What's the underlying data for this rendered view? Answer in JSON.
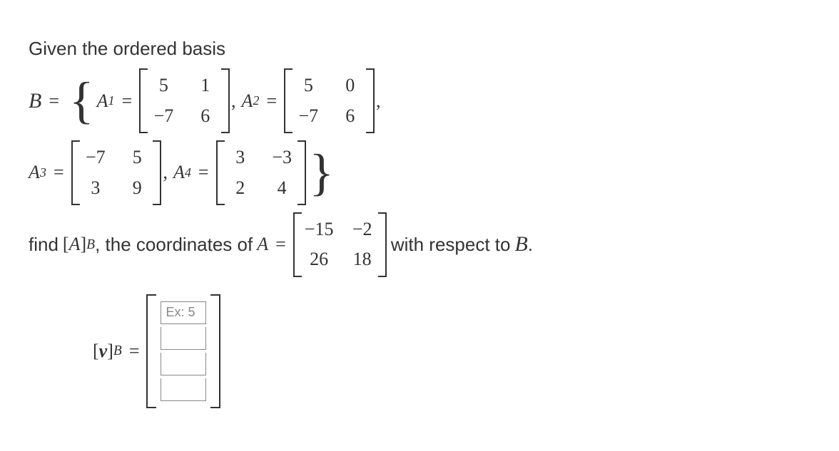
{
  "intro": "Given the ordered basis",
  "problem": {
    "basis_symbol": "B",
    "A1": {
      "name": "A",
      "index": "1",
      "cells": [
        "5",
        "1",
        "−7",
        "6"
      ]
    },
    "A2": {
      "name": "A",
      "index": "2",
      "cells": [
        "5",
        "0",
        "−7",
        "6"
      ]
    },
    "A3": {
      "name": "A",
      "index": "3",
      "cells": [
        "−7",
        "5",
        "3",
        "9"
      ]
    },
    "A4": {
      "name": "A",
      "index": "4",
      "cells": [
        "3",
        "−3",
        "2",
        "4"
      ]
    },
    "find_prefix": "find ",
    "coord_open": "[",
    "coord_A": "A",
    "coord_close": "]",
    "coord_sub": "B",
    "find_mid": ", the coordinates of ",
    "Aeq": "A",
    "target": {
      "cells": [
        "−15",
        "−2",
        "26",
        "18"
      ]
    },
    "find_suffix": " with respect to ",
    "final_B": "B",
    "period": "."
  },
  "answer": {
    "vec_open": "[",
    "vec_v": "v",
    "vec_close": "]",
    "vec_sub": "B",
    "equals": "=",
    "placeholder": "Ex: 5"
  }
}
